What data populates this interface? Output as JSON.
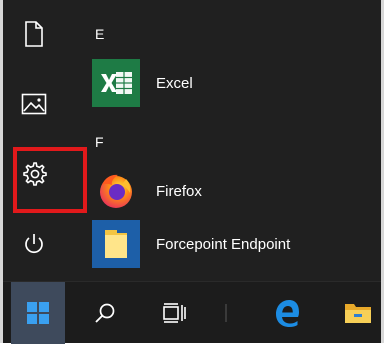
{
  "rail": {
    "items": [
      "documents",
      "pictures",
      "settings",
      "power"
    ]
  },
  "sections": {
    "e": "E",
    "f": "F"
  },
  "apps": {
    "excel": {
      "name": "Excel",
      "icon": "excel-icon"
    },
    "firefox": {
      "name": "Firefox",
      "icon": "firefox-icon"
    },
    "forcepoint": {
      "name": "Forcepoint Endpoint",
      "icon": "folder-icon"
    }
  },
  "taskbar": {
    "items": [
      "start-button",
      "search-button",
      "task-view-button",
      "edge-button",
      "file-explorer-button"
    ]
  },
  "colors": {
    "start_bg": "#202020",
    "highlight": "#e2191b",
    "excel_green": "#1e7b45",
    "edge_blue": "#1c8ce3",
    "start_tile_bg": "#3e4a5c"
  }
}
